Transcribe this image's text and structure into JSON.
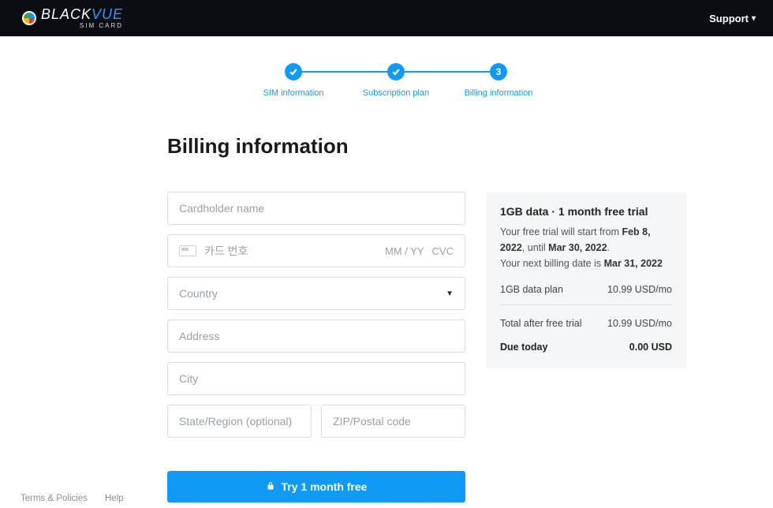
{
  "header": {
    "brand_main_light": "BLACK",
    "brand_main_accent": "VUE",
    "brand_sub": "SIM CARD",
    "support_label": "Support"
  },
  "stepper": {
    "steps": [
      {
        "label": "SIM information",
        "state": "done"
      },
      {
        "label": "Subscription plan",
        "state": "done"
      },
      {
        "label": "Billing information",
        "state": "current",
        "number": "3"
      }
    ]
  },
  "page_title": "Billing information",
  "form": {
    "cardholder_placeholder": "Cardholder name",
    "card_number_placeholder": "카드 번호",
    "card_exp_placeholder": "MM / YY",
    "card_cvc_placeholder": "CVC",
    "country_label": "Country",
    "address_placeholder": "Address",
    "city_placeholder": "City",
    "state_placeholder": "State/Region (optional)",
    "zip_placeholder": "ZIP/Postal code",
    "cta_label": "Try 1 month free"
  },
  "summary": {
    "title": "1GB data · 1 month free trial",
    "trial_prefix": "Your free trial will start from ",
    "trial_start": "Feb 8, 2022",
    "trial_until_prefix": ", until ",
    "trial_end": "Mar 30, 2022",
    "next_billing_prefix": "Your next billing date is ",
    "next_billing_date": "Mar 31, 2022",
    "plan_label": "1GB data plan",
    "plan_price": "10.99 USD/mo",
    "total_label": "Total after free trial",
    "total_price": "10.99 USD/mo",
    "due_label": "Due today",
    "due_price": "0.00 USD"
  },
  "footer": {
    "terms": "Terms & Policies",
    "help": "Help"
  }
}
